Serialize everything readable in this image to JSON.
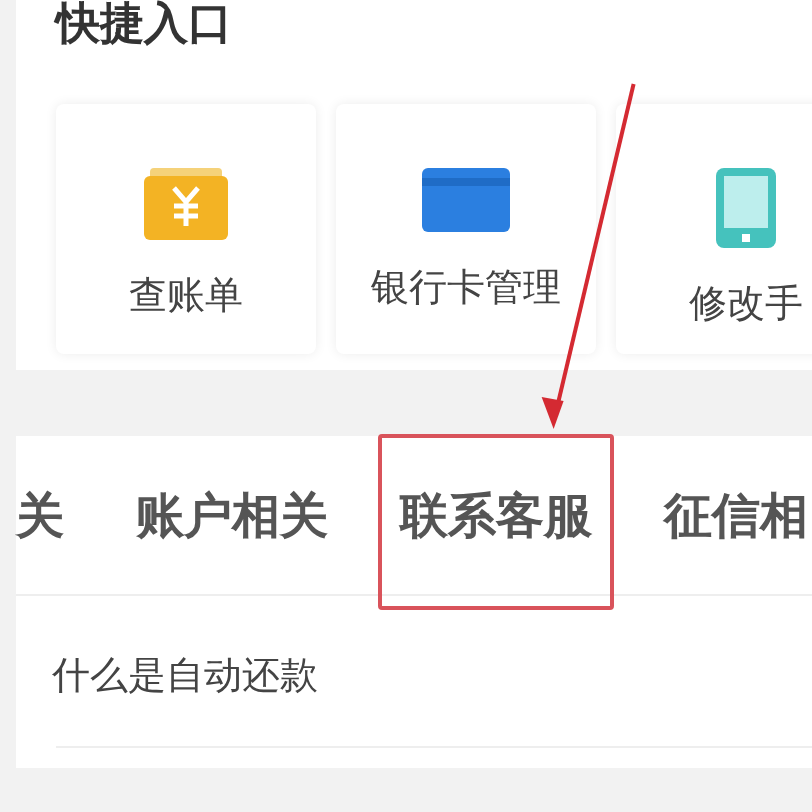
{
  "section_title": "快捷入口",
  "shortcuts": [
    {
      "kind": "bill",
      "label": "查账单"
    },
    {
      "kind": "card",
      "label": "银行卡管理"
    },
    {
      "kind": "phone",
      "label": "修改手"
    }
  ],
  "tabs": [
    {
      "label": "关",
      "highlighted": false
    },
    {
      "label": "账户相关",
      "highlighted": false
    },
    {
      "label": "联系客服",
      "highlighted": true
    },
    {
      "label": "征信相",
      "highlighted": false
    }
  ],
  "questions": [
    "什么是自动还款"
  ]
}
